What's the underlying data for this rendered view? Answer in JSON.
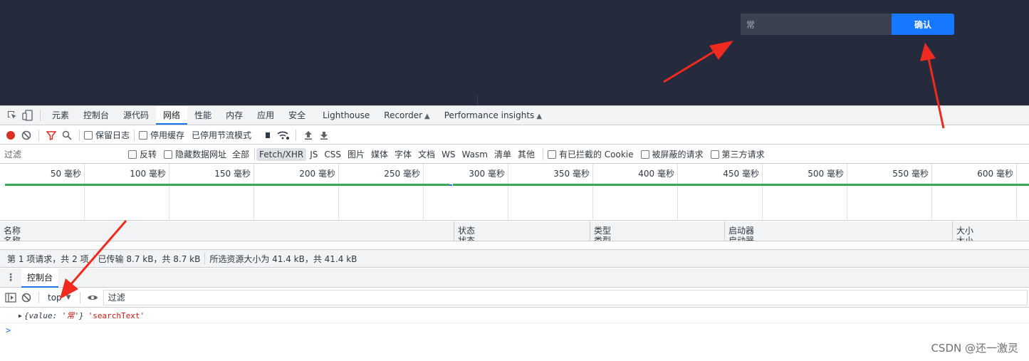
{
  "app": {
    "search_value": "常",
    "confirm_label": "确认",
    "bg_color": "#262a3d",
    "button_color": "#1677ff"
  },
  "devtools": {
    "tabs": [
      "元素",
      "控制台",
      "源代码",
      "网络",
      "性能",
      "内存",
      "应用",
      "安全",
      "Lighthouse",
      "Recorder",
      "Performance insights"
    ],
    "active_tab": "网络",
    "toolbar": {
      "preserve_log": "保留日志",
      "disable_cache": "停用缓存",
      "throttling": "已停用节流模式"
    },
    "filter": {
      "placeholder": "过滤",
      "invert": "反转",
      "hide_data_urls": "隐藏数据网址",
      "all": "全部",
      "types": [
        "Fetch/XHR",
        "JS",
        "CSS",
        "图片",
        "媒体",
        "字体",
        "文档",
        "WS",
        "Wasm",
        "清单",
        "其他"
      ],
      "active_type": "Fetch/XHR",
      "blocked_cookies": "有已拦截的 Cookie",
      "blocked_requests": "被屏蔽的请求",
      "third_party": "第三方请求"
    },
    "timeline": {
      "ticks": [
        "50 毫秒",
        "100 毫秒",
        "150 毫秒",
        "200 毫秒",
        "250 毫秒",
        "300 毫秒",
        "350 毫秒",
        "400 毫秒",
        "450 毫秒",
        "500 毫秒",
        "550 毫秒",
        "600 毫秒"
      ]
    },
    "table": {
      "columns": [
        "名称",
        "状态",
        "类型",
        "启动器",
        "大小"
      ]
    },
    "summary": {
      "requests": "第 1 项请求，共 2 项",
      "transferred": "已传输 8.7 kB，共 8.7 kB",
      "resources": "所选资源大小为 41.4 kB，共 41.4 kB"
    },
    "drawer": {
      "tab": "控制台",
      "context": "top",
      "filter_placeholder": "过滤",
      "log": {
        "object_prefix": "{value: '",
        "object_value": "常",
        "object_suffix": "'}",
        "string": "'searchText'"
      },
      "prompt": ">"
    }
  },
  "watermark": "CSDN @还一激灵"
}
